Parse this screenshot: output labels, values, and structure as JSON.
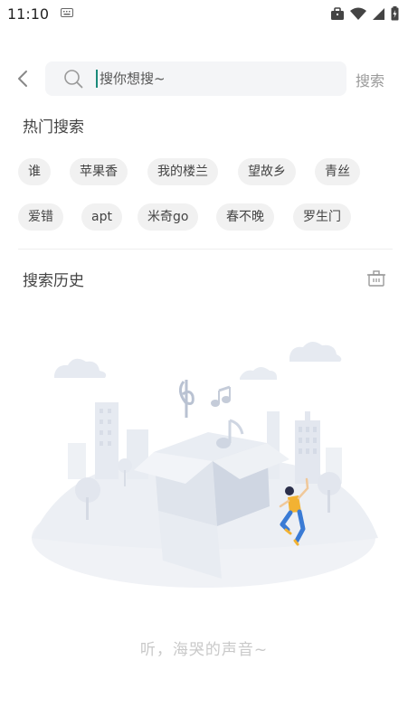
{
  "status_bar": {
    "time": "11:10"
  },
  "search": {
    "placeholder": "搜你想搜~",
    "submit_label": "搜索"
  },
  "hot": {
    "title": "热门搜索",
    "tags": [
      "谁",
      "苹果香",
      "我的楼兰",
      "望故乡",
      "青丝",
      "爱错",
      "apt",
      "米奇go",
      "春不晚",
      "罗生门"
    ]
  },
  "history": {
    "title": "搜索历史"
  },
  "empty_state": {
    "text": "听，海哭的声音~"
  },
  "colors": {
    "accent": "#1a8a7a",
    "tag_bg": "#f1f1f1",
    "search_bg": "#f4f5f7",
    "muted": "#9a9a9a"
  }
}
